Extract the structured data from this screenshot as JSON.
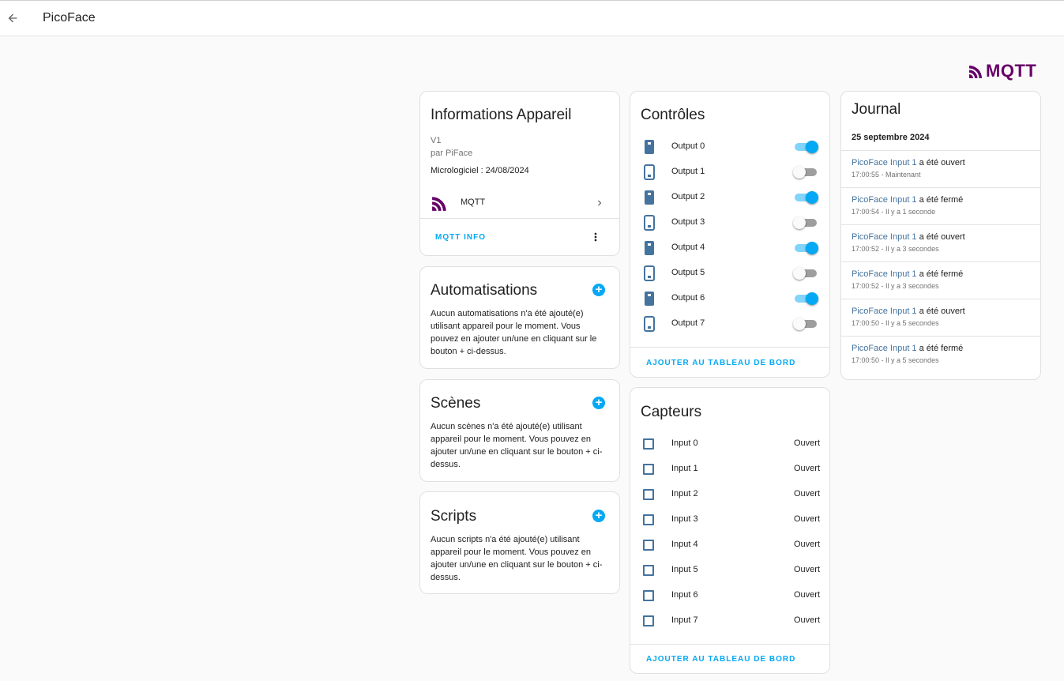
{
  "header": {
    "title": "PicoFace",
    "back_icon": "arrow-left-icon"
  },
  "brand_logo": {
    "text": "MQTT",
    "color": "#660066"
  },
  "device_info": {
    "title": "Informations Appareil",
    "model": "V1",
    "manufacturer": "par PiFace",
    "firmware": "Micrologiciel : 24/08/2024",
    "integration": "MQTT",
    "action": "MQTT INFO"
  },
  "automations": {
    "title": "Automatisations",
    "empty": "Aucun automatisations n'a été ajouté(e) utilisant appareil pour le moment. Vous pouvez en ajouter un/une en cliquant sur le bouton + ci-dessus."
  },
  "scenes": {
    "title": "Scènes",
    "empty": "Aucun scènes n'a été ajouté(e) utilisant appareil pour le moment. Vous pouvez en ajouter un/une en cliquant sur le bouton + ci-dessus."
  },
  "scripts": {
    "title": "Scripts",
    "empty": "Aucun scripts n'a été ajouté(e) utilisant appareil pour le moment. Vous pouvez en ajouter un/une en cliquant sur le bouton + ci-dessus."
  },
  "controls": {
    "title": "Contrôles",
    "items": [
      {
        "label": "Output 0",
        "on": true
      },
      {
        "label": "Output 1",
        "on": false
      },
      {
        "label": "Output 2",
        "on": true
      },
      {
        "label": "Output 3",
        "on": false
      },
      {
        "label": "Output 4",
        "on": true
      },
      {
        "label": "Output 5",
        "on": false
      },
      {
        "label": "Output 6",
        "on": true
      },
      {
        "label": "Output 7",
        "on": false
      }
    ],
    "action": "AJOUTER AU TABLEAU DE BORD"
  },
  "sensors": {
    "title": "Capteurs",
    "items": [
      {
        "label": "Input 0",
        "state": "Ouvert"
      },
      {
        "label": "Input 1",
        "state": "Ouvert"
      },
      {
        "label": "Input 2",
        "state": "Ouvert"
      },
      {
        "label": "Input 3",
        "state": "Ouvert"
      },
      {
        "label": "Input 4",
        "state": "Ouvert"
      },
      {
        "label": "Input 5",
        "state": "Ouvert"
      },
      {
        "label": "Input 6",
        "state": "Ouvert"
      },
      {
        "label": "Input 7",
        "state": "Ouvert"
      }
    ],
    "action": "AJOUTER AU TABLEAU DE BORD"
  },
  "logbook": {
    "title": "Journal",
    "date": "25 septembre 2024",
    "entries": [
      {
        "entity": "PicoFace Input 1",
        "action": "a été ouvert",
        "time": "17:00:55 - Maintenant"
      },
      {
        "entity": "PicoFace Input 1",
        "action": "a été fermé",
        "time": "17:00:54 - Il y a 1 seconde"
      },
      {
        "entity": "PicoFace Input 1",
        "action": "a été ouvert",
        "time": "17:00:52 - Il y a 3 secondes"
      },
      {
        "entity": "PicoFace Input 1",
        "action": "a été fermé",
        "time": "17:00:52 - Il y a 3 secondes"
      },
      {
        "entity": "PicoFace Input 1",
        "action": "a été ouvert",
        "time": "17:00:50 - Il y a 5 secondes"
      },
      {
        "entity": "PicoFace Input 1",
        "action": "a été fermé",
        "time": "17:00:50 - Il y a 5 secondes"
      }
    ]
  },
  "colors": {
    "accent": "#03a9f4",
    "icon": "#44739e",
    "mqtt": "#660066"
  }
}
